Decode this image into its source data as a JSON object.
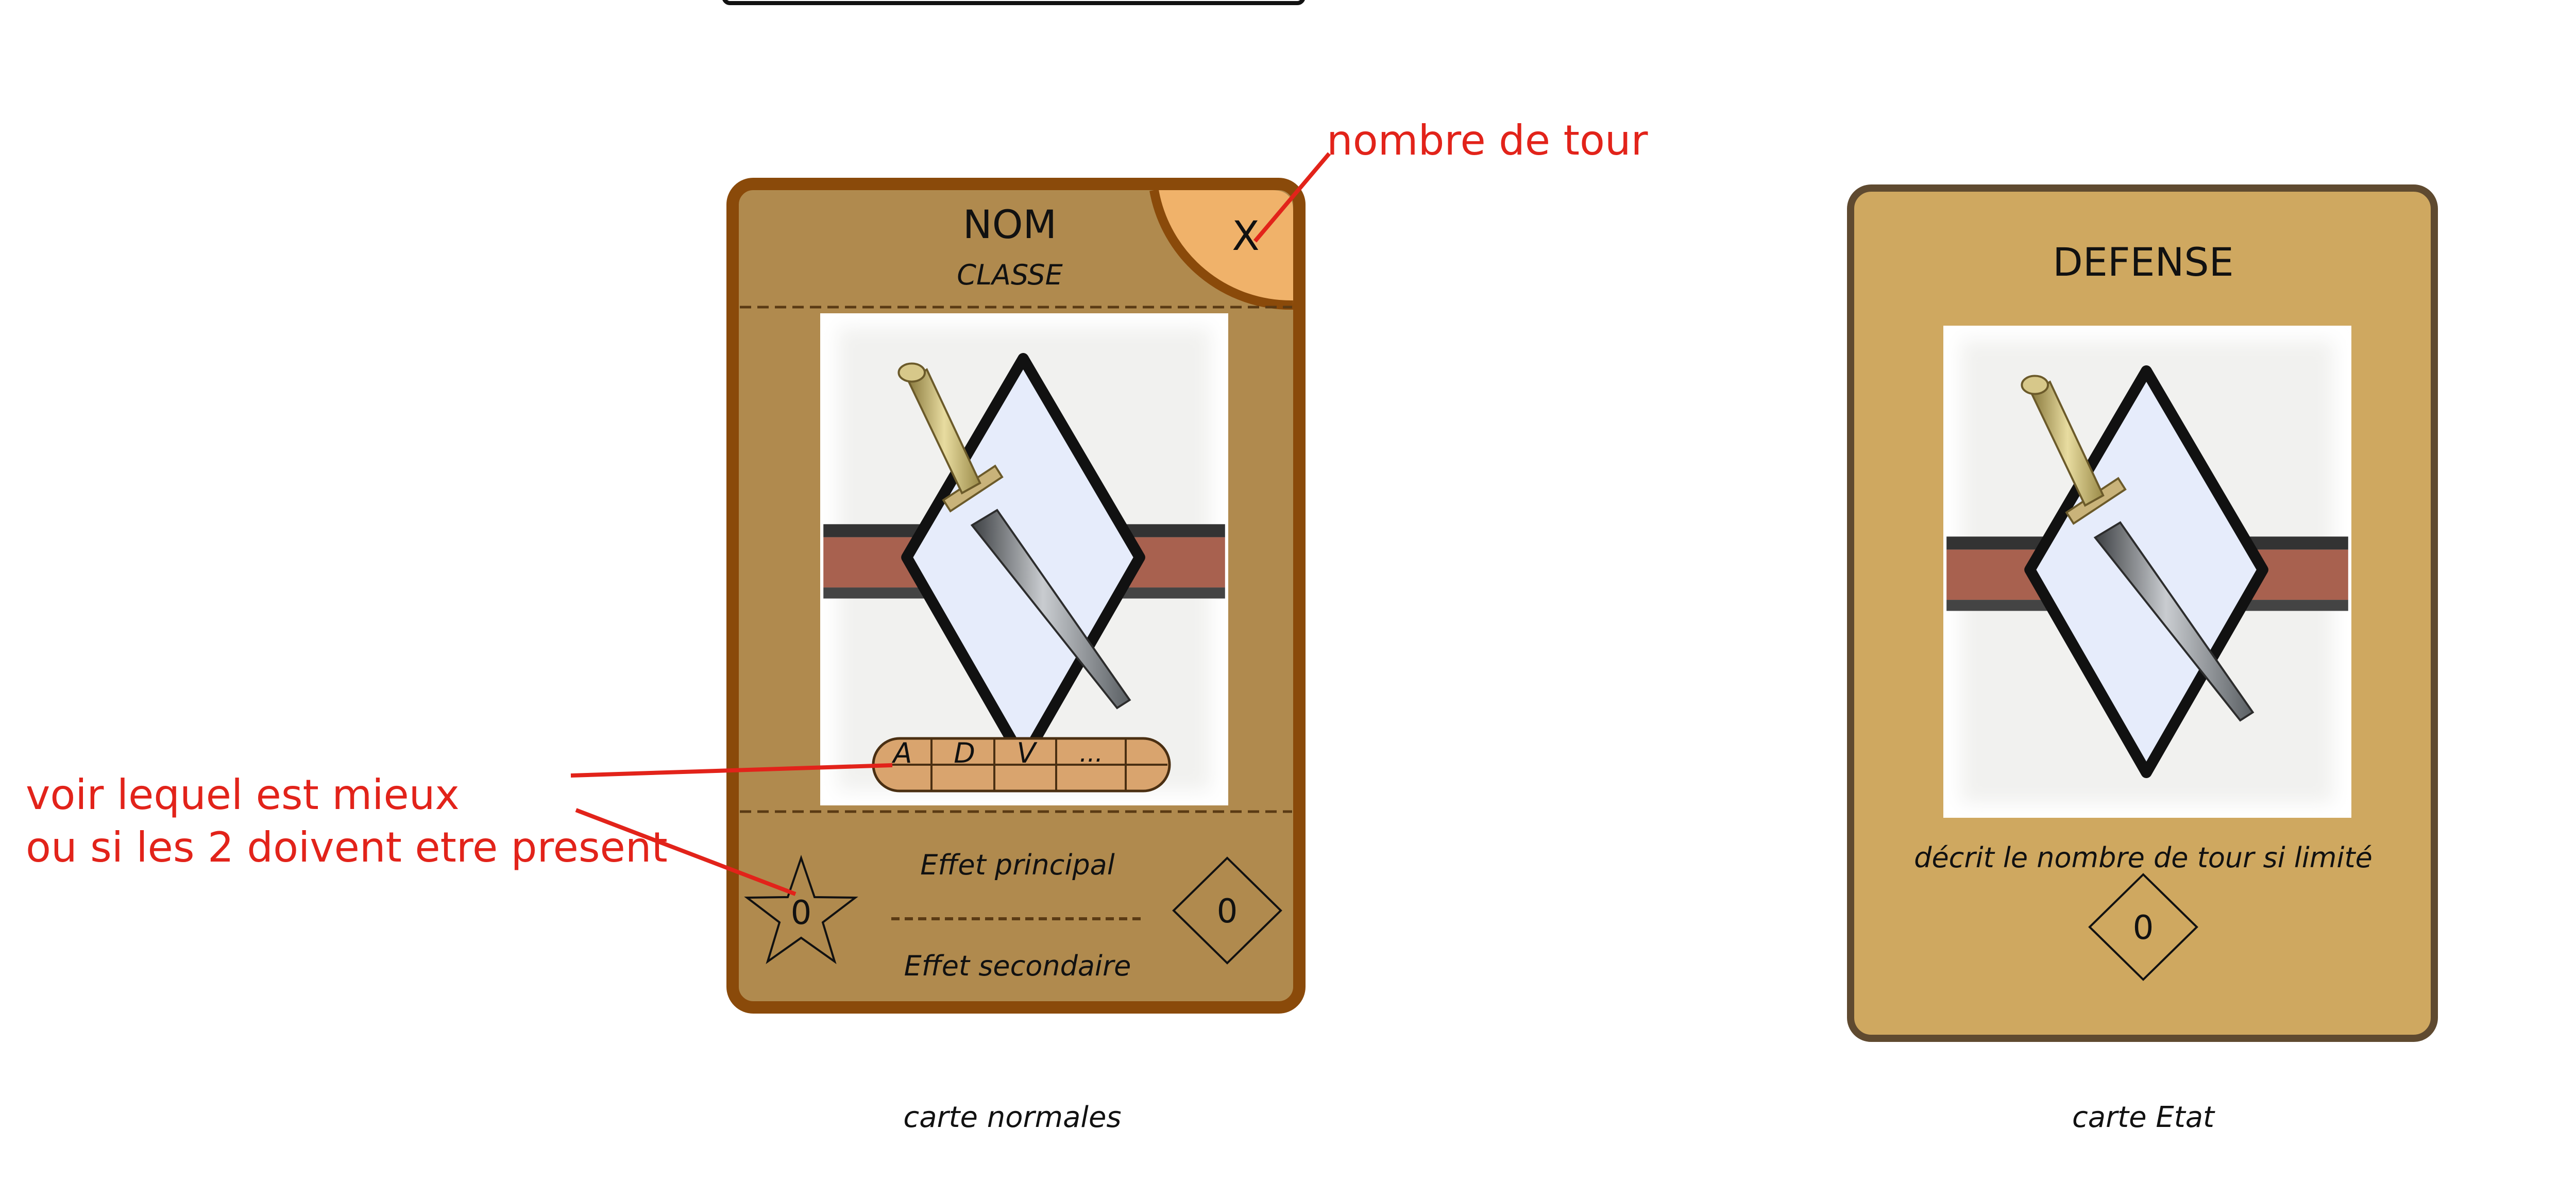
{
  "colors": {
    "background": "#ffffff",
    "annotation_red": "#e2231a",
    "normal_card_fill": "#b08a4e",
    "normal_card_border": "#8a4a0a",
    "turn_corner_fill": "#f0b26a",
    "state_card_fill": "#cfa860",
    "state_card_border": "#5f4a30",
    "text_dark": "#111111"
  },
  "annotations": {
    "turn_count": "nombre de tour",
    "compare_line1": "voir lequel est mieux",
    "compare_line2": "ou si les 2 doivent etre present"
  },
  "normal_card": {
    "caption": "carte normales",
    "name": "NOM",
    "class": "CLASSE",
    "turn_value": "X",
    "stats": [
      "A",
      "D",
      "V",
      "..."
    ],
    "main_effect": "Effet principal",
    "secondary_effect": "Effet secondaire",
    "star_value": "0",
    "diamond_value": "0",
    "art_icons": [
      "dagger-icon",
      "diamond-shield-icon"
    ]
  },
  "state_card": {
    "caption": "carte Etat",
    "title": "DEFENSE",
    "description": "décrit le nombre de tour si limité",
    "diamond_value": "0",
    "art_icons": [
      "dagger-icon",
      "diamond-shield-icon"
    ]
  }
}
